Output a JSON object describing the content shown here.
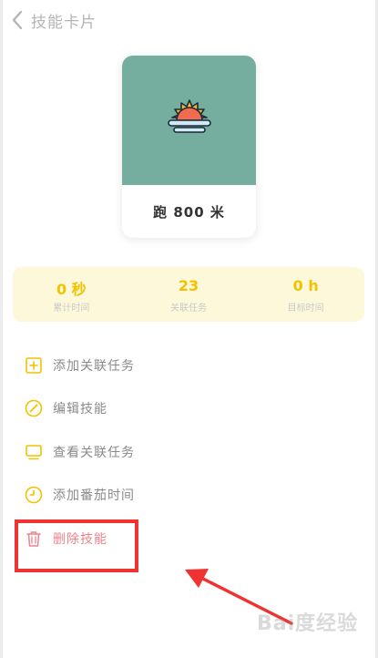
{
  "header": {
    "title": "技能卡片",
    "back_icon": "chevron-left-icon"
  },
  "card": {
    "name": "跑 800 米",
    "icon": "sunrise-icon",
    "bg_color": "#75ae9f"
  },
  "stats": [
    {
      "value": "0 秒",
      "label": "累计时间"
    },
    {
      "value": "23",
      "label": "关联任务"
    },
    {
      "value": "0 h",
      "label": "目标时间"
    }
  ],
  "menu": [
    {
      "label": "添加关联任务",
      "icon": "plus-square-icon"
    },
    {
      "label": "编辑技能",
      "icon": "edit-circle-icon"
    },
    {
      "label": "查看关联任务",
      "icon": "monitor-icon"
    },
    {
      "label": "添加番茄时间",
      "icon": "clock-icon"
    },
    {
      "label": "删除技能",
      "icon": "trash-icon"
    }
  ],
  "colors": {
    "accent": "#f2c200",
    "danger": "#f0828a",
    "annotation": "#ef3333"
  },
  "watermark": "Bai度经验"
}
